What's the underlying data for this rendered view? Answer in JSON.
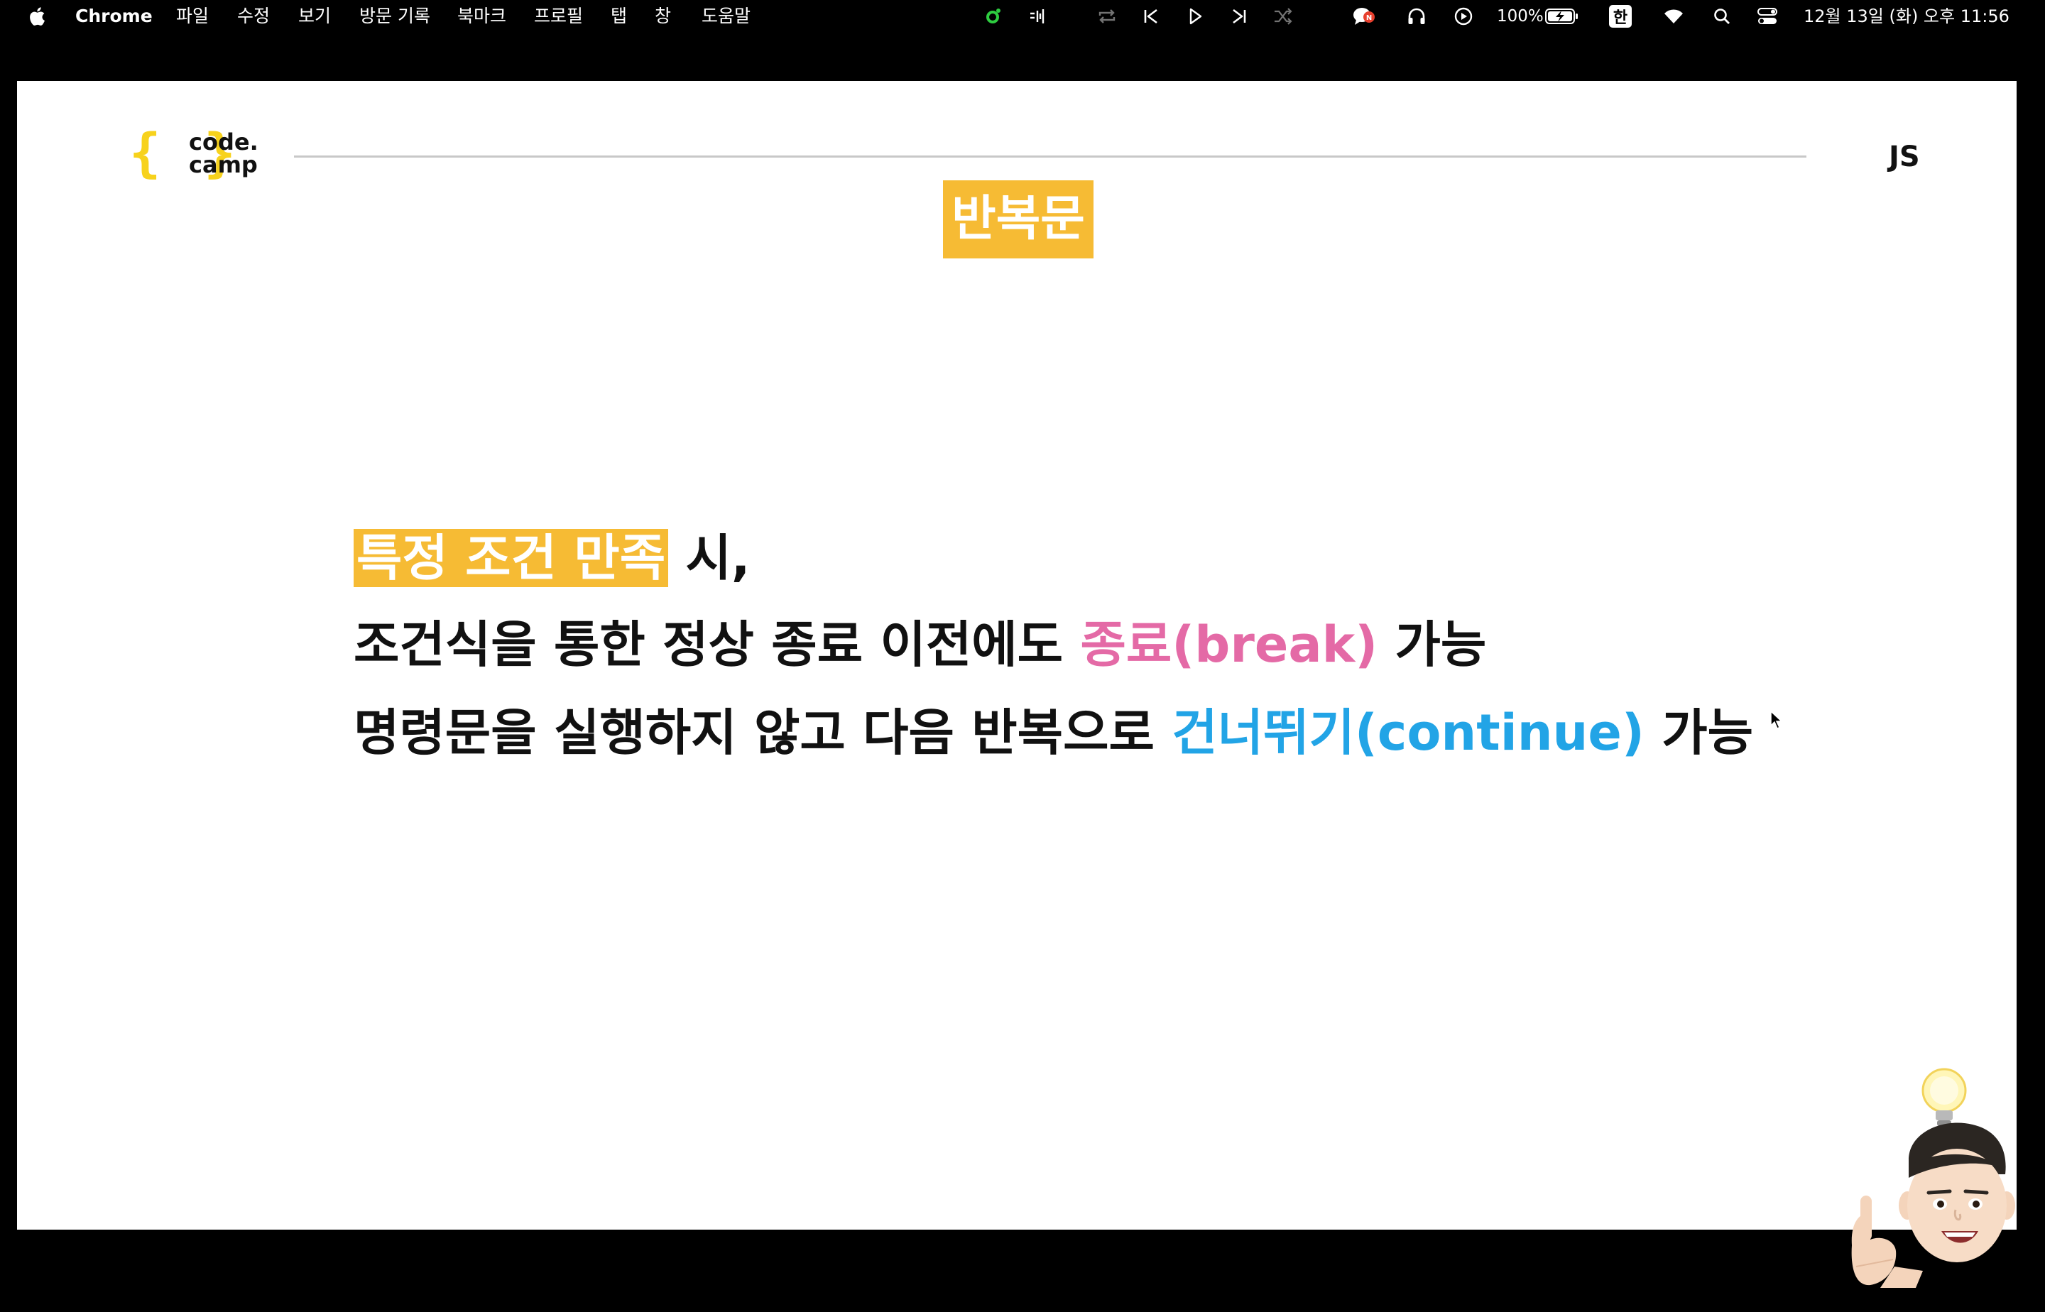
{
  "menubar": {
    "apple_icon": "apple-logo-icon",
    "app_name": "Chrome",
    "menus": [
      "파일",
      "수정",
      "보기",
      "방문 기록",
      "북마크",
      "프로필",
      "탭",
      "창",
      "도움말"
    ],
    "battery_percent": "100%",
    "input_method": "한",
    "datetime": "12월 13일 (화) 오후 11:56",
    "icons": [
      "green-status-icon",
      "sound-wave-icon",
      "repeat-icon",
      "previous-track-icon",
      "play-icon",
      "next-track-icon",
      "shuffle-icon",
      "notification-icon",
      "headphones-icon",
      "play-circle-icon",
      "battery-charging-icon",
      "wifi-icon",
      "search-icon",
      "control-center-icon"
    ]
  },
  "slide": {
    "logo": {
      "line1": "code.",
      "line2": "camp",
      "braces": "{ }"
    },
    "js_label": "JS",
    "title": "반복문",
    "line1": {
      "highlight": "특정 조건 만족",
      "rest": " 시,"
    },
    "line2": {
      "before": "조건식을 통한 정상 종료 이전에도 ",
      "accent": "종료(break)",
      "after": " 가능"
    },
    "line3": {
      "before": "명령문을 실행하지 않고 다음 반복으로 ",
      "accent": "건너뛰기(continue)",
      "after": " 가능"
    }
  },
  "colors": {
    "highlight_yellow": "#f6bb34",
    "logo_yellow": "#f7d21c",
    "break_pink": "#e46aa6",
    "continue_blue": "#22a4e6"
  }
}
